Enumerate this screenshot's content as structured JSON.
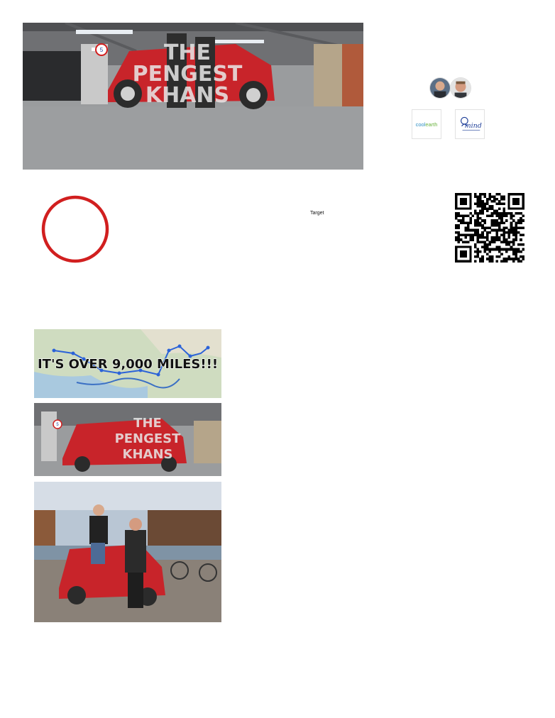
{
  "hero": {
    "title_line1": "THE",
    "title_line2": "PENGEST",
    "title_line3": "KHANS",
    "sign_number": "5"
  },
  "team": {
    "members": [
      {
        "name": "team-member-1"
      },
      {
        "name": "team-member-2"
      }
    ]
  },
  "charities": [
    {
      "name": "coolearth",
      "cool": "cool",
      "earth": "earth"
    },
    {
      "name": "mind",
      "label": "mind"
    }
  ],
  "fundraising": {
    "target_label": "Target",
    "progress_fraction": 0,
    "ring_color": "#d11f1f"
  },
  "gallery": {
    "map_banner_text": "IT'S OVER 9,000 MILES!!!",
    "car_title_line1": "THE",
    "car_title_line2": "PENGEST",
    "car_title_line3": "KHANS",
    "car_sign_number": "5"
  },
  "colors": {
    "car_red": "#c8242a",
    "route_blue": "#2b62d8",
    "sky": "#b9c6d4"
  },
  "icons": {
    "qr": "qr-code-icon"
  }
}
